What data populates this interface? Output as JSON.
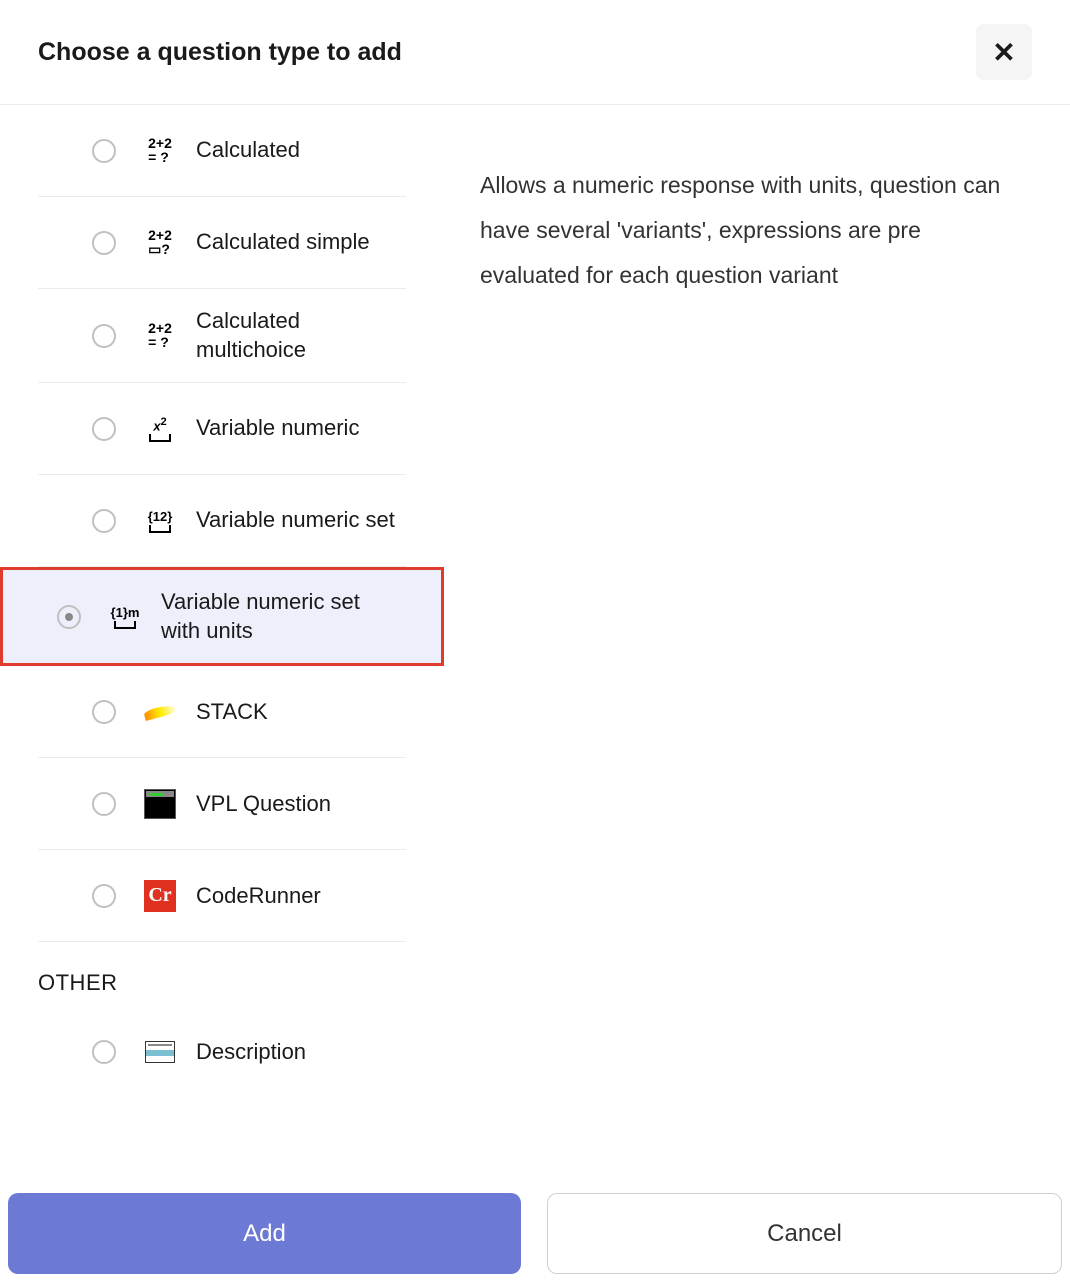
{
  "dialog": {
    "title": "Choose a question type to add"
  },
  "description": "Allows a numeric response with units, question can have several 'variants', expressions are pre evaluated for each question variant",
  "items": [
    {
      "id": "calculated",
      "label": "Calculated",
      "icon": "calc-icon",
      "selected": false
    },
    {
      "id": "calculated-simple",
      "label": "Calculated simple",
      "icon": "calc-simple-icon",
      "selected": false
    },
    {
      "id": "calculated-multichoice",
      "label": "Calculated multichoice",
      "icon": "calc-multi-icon",
      "selected": false
    },
    {
      "id": "variable-numeric",
      "label": "Variable numeric",
      "icon": "varnum-icon",
      "selected": false
    },
    {
      "id": "variable-numeric-set",
      "label": "Variable numeric set",
      "icon": "varnum-set-icon",
      "selected": false
    },
    {
      "id": "variable-numeric-set-units",
      "label": "Variable numeric set with units",
      "icon": "varnum-units-icon",
      "selected": true
    },
    {
      "id": "stack",
      "label": "STACK",
      "icon": "stack-icon",
      "selected": false
    },
    {
      "id": "vpl",
      "label": "VPL Question",
      "icon": "vpl-icon",
      "selected": false
    },
    {
      "id": "coderunner",
      "label": "CodeRunner",
      "icon": "coderunner-icon",
      "selected": false
    }
  ],
  "other_section": {
    "header": "OTHER",
    "items": [
      {
        "id": "description",
        "label": "Description",
        "icon": "description-icon",
        "selected": false
      }
    ]
  },
  "buttons": {
    "add": "Add",
    "cancel": "Cancel"
  }
}
